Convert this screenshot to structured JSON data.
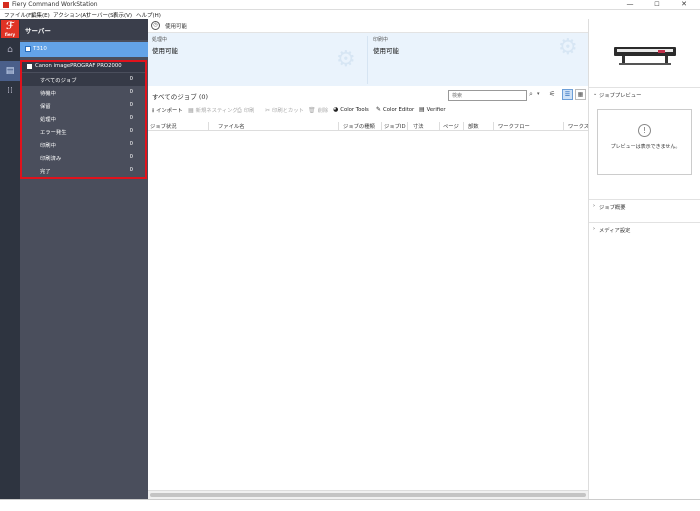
{
  "window": {
    "title": "Fiery Command WorkStation",
    "minimize": "—",
    "maximize": "☐",
    "close": "✕"
  },
  "menu": [
    "ファイル(F)",
    "編集(E)",
    "アクション(A)",
    "サーバー(S)",
    "表示(V)",
    "ヘルプ(H)"
  ],
  "rail": {
    "logo_text": "fiery"
  },
  "servers": {
    "header": "サーバー",
    "server_name": "T310",
    "printer_name": "Canon imagePROGRAF PRO2000",
    "queues": [
      {
        "label": "すべてのジョブ",
        "count": "0"
      },
      {
        "label": "待機中",
        "count": "0"
      },
      {
        "label": "保留",
        "count": "0"
      },
      {
        "label": "処理中",
        "count": "0"
      },
      {
        "label": "エラー発生",
        "count": "0"
      },
      {
        "label": "印刷中",
        "count": "0"
      },
      {
        "label": "印刷済み",
        "count": "0"
      },
      {
        "label": "完了",
        "count": "0"
      }
    ]
  },
  "status": {
    "top_text": "使用可能",
    "processing_caption": "処理中",
    "processing_value": "使用可能",
    "printing_caption": "印刷中",
    "printing_value": "使用可能"
  },
  "jobs": {
    "title": "すべてのジョブ (0)",
    "search_placeholder": "検索"
  },
  "toolbar": [
    {
      "label": "インポート",
      "icon": "⭳",
      "enabled": true
    },
    {
      "label": "新規ネスティング",
      "icon": "▦",
      "enabled": false
    },
    {
      "label": "印刷",
      "icon": "⎙",
      "enabled": false
    },
    {
      "label": "印刷とカット",
      "icon": "✂",
      "enabled": false
    },
    {
      "label": "削除",
      "icon": "🗑",
      "enabled": false
    },
    {
      "label": "Color Tools",
      "icon": "◕",
      "enabled": true
    },
    {
      "label": "Color Editor",
      "icon": "✎",
      "enabled": true
    },
    {
      "label": "Verifier",
      "icon": "▤",
      "enabled": true
    }
  ],
  "columns": [
    "ジョブ状況",
    "ファイル名",
    "ジョブの種類",
    "ジョブID",
    "寸法",
    "ページ",
    "部数",
    "ワークフロー",
    "ワークスペ"
  ],
  "right_panel": {
    "preview_header": "ジョブプレビュー",
    "preview_message": "プレビューは表示できません。",
    "summary_header": "ジョブ概要",
    "media_header": "メディア設定"
  }
}
